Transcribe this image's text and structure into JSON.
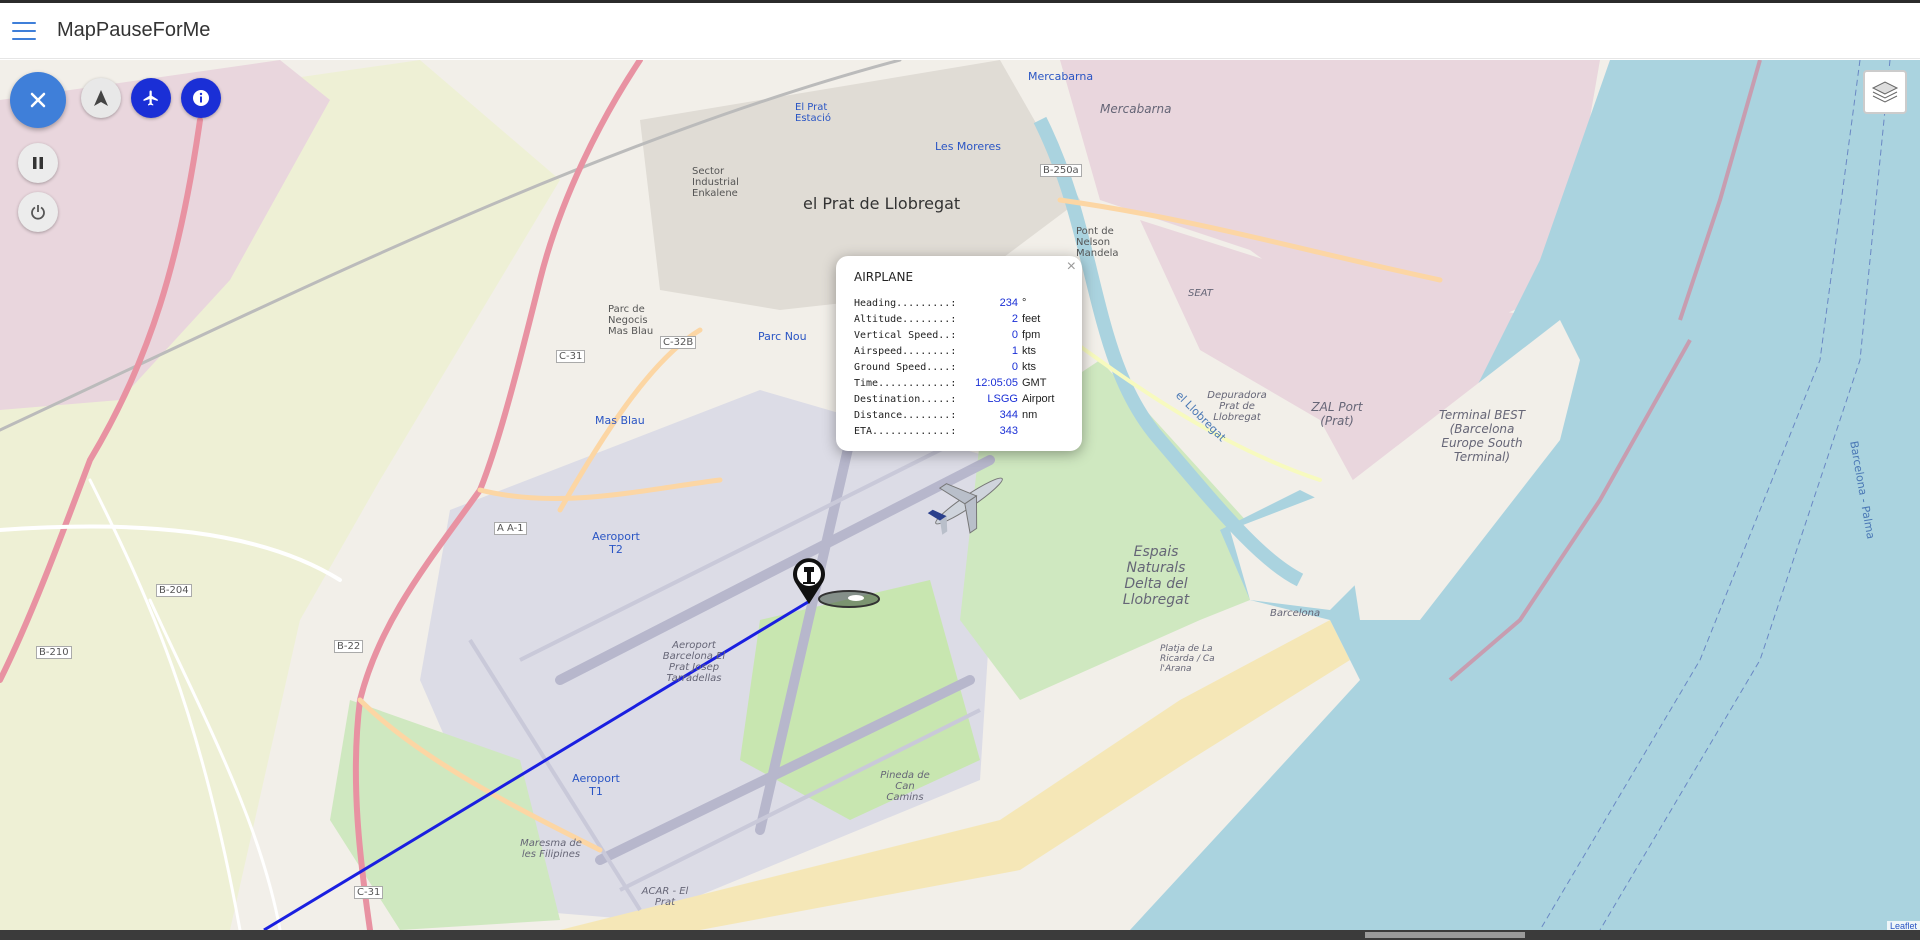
{
  "app": {
    "title": "MapPauseForMe"
  },
  "controls": {
    "close_icon": "close-icon",
    "north_icon": "north-arrow-icon",
    "plane_icon": "airplane-icon",
    "info_icon": "info-icon",
    "pause_icon": "pause-icon",
    "power_icon": "power-icon",
    "layers_icon": "layers-icon",
    "accent": "#3f7fd9",
    "plane_blue": "#1a2fd6"
  },
  "popup": {
    "title": "AIRPLANE",
    "close": "×",
    "rows": [
      {
        "key": "Heading.........:",
        "value": "234",
        "unit": "°"
      },
      {
        "key": "Altitude........:",
        "value": "2",
        "unit": "feet"
      },
      {
        "key": "Vertical Speed..:",
        "value": "0",
        "unit": "fpm"
      },
      {
        "key": "Airspeed........:",
        "value": "1",
        "unit": "kts"
      },
      {
        "key": "Ground Speed....:",
        "value": "0",
        "unit": "kts"
      },
      {
        "key": "Time............:",
        "value": "12:05:05",
        "unit": "GMT"
      },
      {
        "key": "Destination.....:",
        "value": "LSGG",
        "unit": "Airport"
      },
      {
        "key": "Distance........:",
        "value": "344",
        "unit": "nm"
      },
      {
        "key": "ETA.............:",
        "value": "343",
        "unit": ""
      }
    ]
  },
  "map_labels": {
    "prat": "el Prat de Llobregat",
    "mercabarna": "Mercabarna",
    "mercabarna2": "Mercabarna",
    "sector": "Sector Industrial Enkalene",
    "estacio": "El Prat Estació",
    "lesmoreres": "Les Moreres",
    "parcnou": "Parc Nou",
    "masblau": "Mas Blau",
    "parcnegocis": "Parc de Negocis Mas Blau",
    "t2": "Aeroport T2",
    "t1": "Aeroport T1",
    "airport": "Aeroport Barcelona El Prat Josep Tarradellas",
    "espais": "Espais Naturals Delta del Llobregat",
    "zal": "ZAL Port (Prat)",
    "best": "Terminal BEST (Barcelona Europe South Terminal)",
    "depuradora": "Depuradora Prat de Llobregat",
    "seat": "SEAT",
    "pontnelson": "Pont de Nelson Mandela",
    "llobregat_river": "el Llobregat",
    "maresma": "Maresma de les Filipines",
    "pineda": "Pineda de Can Camins",
    "platja": "Platja de La Ricarda / Ca l'Arana",
    "barcelona_beach": "Barcelona",
    "acar": "ACAR - El Prat",
    "b250a": "B-250a",
    "b204": "B-204",
    "b210": "B-210",
    "b22": "B-22",
    "c31": "C-31",
    "c31b": "C-31",
    "c32b": "C-32B",
    "aa1": "A A-1",
    "sea_route": "Barcelona - Palma"
  },
  "attribution": "Leaflet"
}
